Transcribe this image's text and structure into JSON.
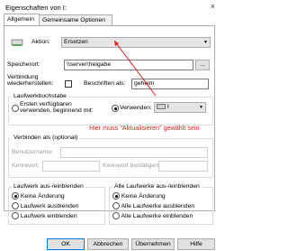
{
  "window": {
    "title": "Eigenschaften von I:",
    "close": "×"
  },
  "tabs": [
    {
      "label": "Allgemein"
    },
    {
      "label": "Gemeinsame Optionen"
    }
  ],
  "action": {
    "label": "Aktion:",
    "value": "Ersetzen"
  },
  "location": {
    "label": "Speicherort:",
    "value": "\\\\server\\freigabe",
    "browse": "..."
  },
  "reconnect": {
    "label": "Verbindung wiederherstellen:",
    "label_line1": "Verbindung",
    "label_line2": "wiederherstellen:"
  },
  "label_as": {
    "label": "Beschriften als:",
    "value": "geheim"
  },
  "drive_letter": {
    "legend": "Laufwerkbuchstabe",
    "first_available_line1": "Ersten verfügbaren",
    "first_available_line2": "verwenden, beginnend mit:",
    "use_label": "Verwenden:",
    "drive_value": "I"
  },
  "annotation": {
    "text": "Hier muss \"Aktualisieren\" gewählt sein",
    "color": "#e3201b"
  },
  "connect_as": {
    "legend": "Verbinden als (optional)",
    "username": "Benutzername:",
    "password": "Kennwort:",
    "confirm": "Kennwort bestätigen:"
  },
  "drive_show_hide": {
    "legend": "Laufwerk aus-/einblenden",
    "options": [
      "Keine Änderung",
      "Laufwerk ausblenden",
      "Laufwerk einblenden"
    ]
  },
  "all_drives": {
    "legend": "Alle Laufwerke aus-/einblenden",
    "options": [
      "Keine Änderung",
      "Alle Laufwerke ausblenden",
      "Alle Laufwerke einblenden"
    ]
  },
  "buttons": {
    "ok": "OK",
    "cancel": "Abbrechen",
    "apply": "Übernehmen",
    "help": "Hilfe"
  }
}
